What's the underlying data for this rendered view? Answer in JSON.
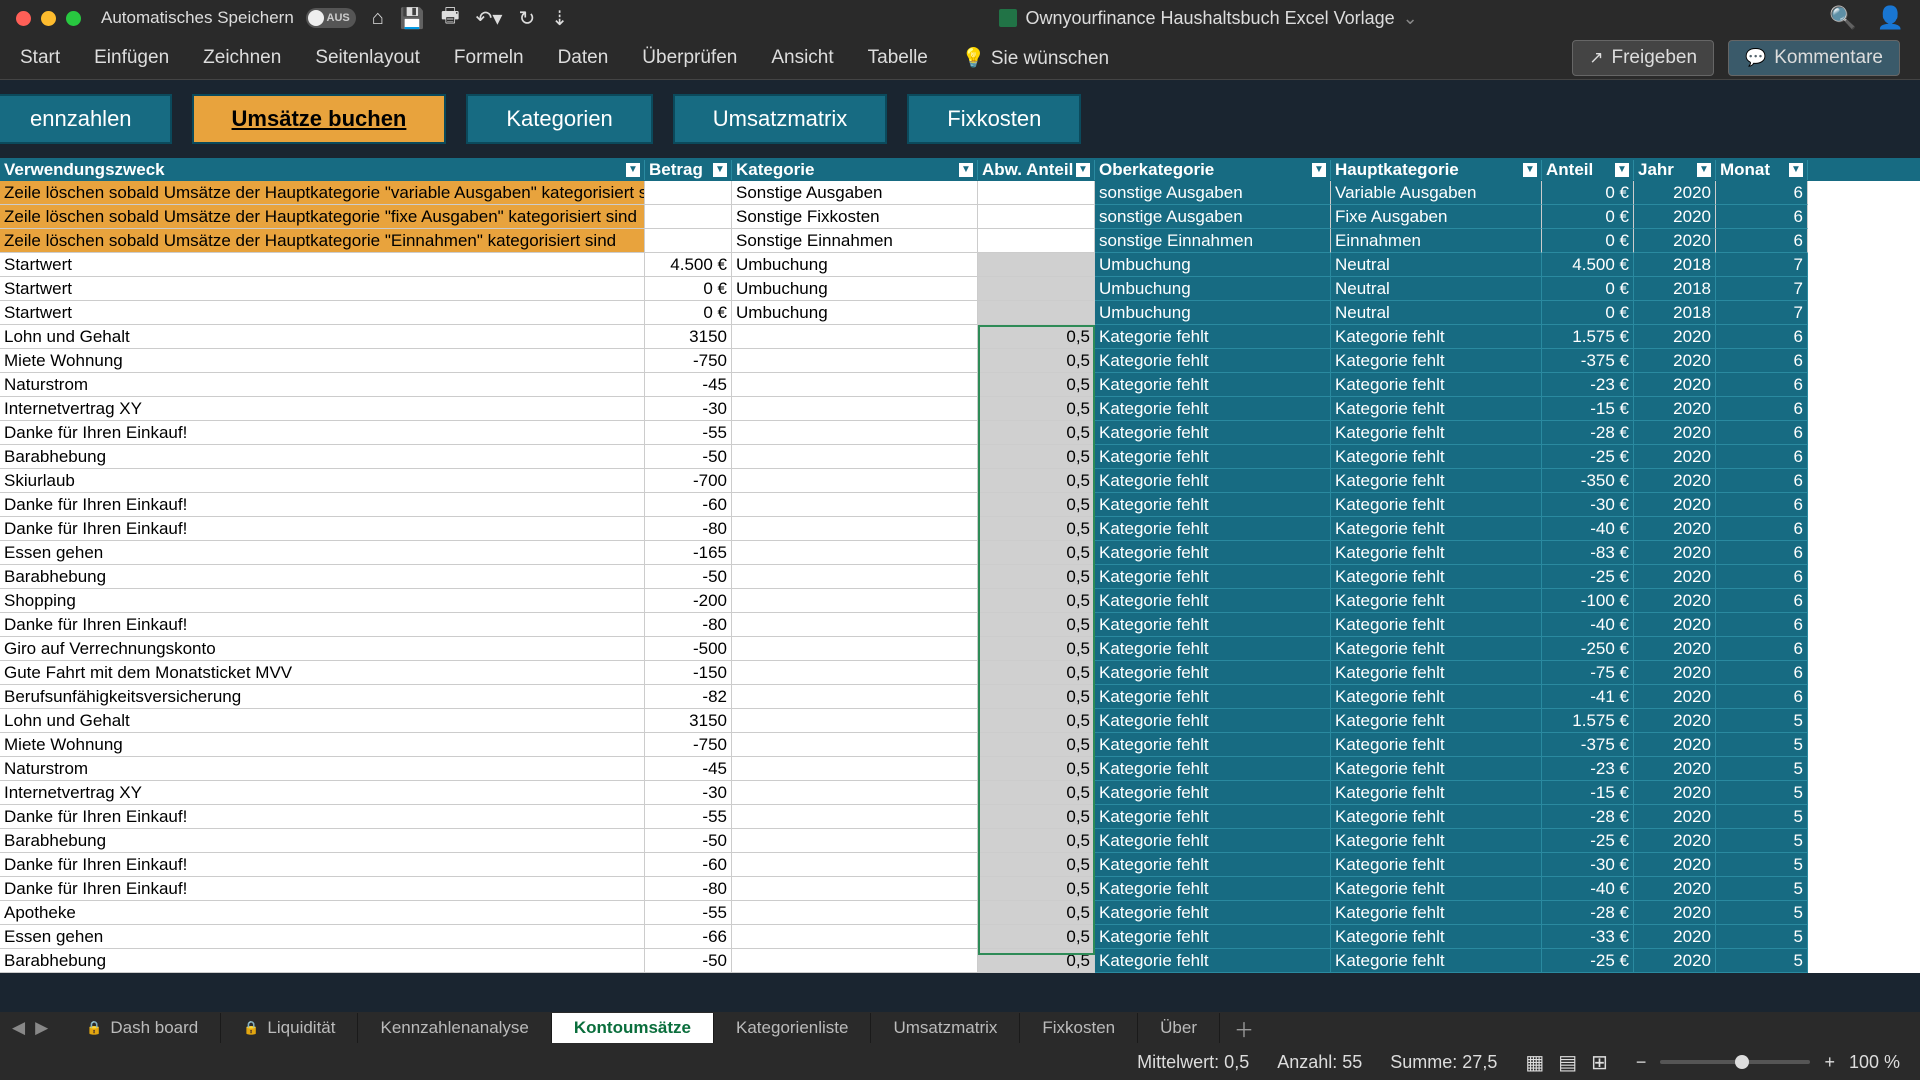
{
  "titlebar": {
    "autosave_label": "Automatisches Speichern",
    "autosave_state": "AUS",
    "doc_title": "Ownyourfinance Haushaltsbuch Excel Vorlage"
  },
  "ribbon": {
    "tabs": [
      "Start",
      "Einfügen",
      "Zeichnen",
      "Seitenlayout",
      "Formeln",
      "Daten",
      "Überprüfen",
      "Ansicht",
      "Tabelle",
      "Sie wünschen"
    ],
    "share": "Freigeben",
    "comments": "Kommentare"
  },
  "nav": {
    "kennzahlen": "ennzahlen",
    "umsaetze": "Umsätze buchen",
    "kategorien": "Kategorien",
    "umsatzmatrix": "Umsatzmatrix",
    "fixkosten": "Fixkosten"
  },
  "headers": {
    "verwend": "Verwendungszweck",
    "betrag": "Betrag",
    "kategorie": "Kategorie",
    "abw": "Abw. Anteil",
    "oberkat": "Oberkategorie",
    "hauptkat": "Hauptkategorie",
    "anteil": "Anteil",
    "jahr": "Jahr",
    "monat": "Monat"
  },
  "rows": [
    {
      "hi": true,
      "verwend": "Zeile löschen sobald Umsätze der Hauptkategorie \"variable Ausgaben\" kategorisiert sind",
      "betrag": "",
      "kategorie": "Sonstige Ausgaben",
      "abw": "",
      "oberkat": "sonstige Ausgaben",
      "hauptkat": "Variable Ausgaben",
      "anteil": "0 €",
      "jahr": "2020",
      "monat": "6"
    },
    {
      "hi": true,
      "verwend": "Zeile löschen sobald Umsätze der Hauptkategorie \"fixe Ausgaben\" kategorisiert sind",
      "betrag": "",
      "kategorie": "Sonstige Fixkosten",
      "abw": "",
      "oberkat": "sonstige Ausgaben",
      "hauptkat": "Fixe Ausgaben",
      "anteil": "0 €",
      "jahr": "2020",
      "monat": "6"
    },
    {
      "hi": true,
      "verwend": "Zeile löschen sobald Umsätze der Hauptkategorie \"Einnahmen\" kategorisiert sind",
      "betrag": "",
      "kategorie": "Sonstige Einnahmen",
      "abw": "",
      "oberkat": "sonstige Einnahmen",
      "hauptkat": "Einnahmen",
      "anteil": "0 €",
      "jahr": "2020",
      "monat": "6"
    },
    {
      "verwend": "Startwert",
      "betrag": "4.500 €",
      "kategorie": "Umbuchung",
      "abw": "",
      "oberkat": "Umbuchung",
      "hauptkat": "Neutral",
      "anteil": "4.500 €",
      "jahr": "2018",
      "monat": "7"
    },
    {
      "verwend": "Startwert",
      "betrag": "0 €",
      "kategorie": "Umbuchung",
      "abw": "",
      "oberkat": "Umbuchung",
      "hauptkat": "Neutral",
      "anteil": "0 €",
      "jahr": "2018",
      "monat": "7"
    },
    {
      "verwend": "Startwert",
      "betrag": "0 €",
      "kategorie": "Umbuchung",
      "abw": "",
      "oberkat": "Umbuchung",
      "hauptkat": "Neutral",
      "anteil": "0 €",
      "jahr": "2018",
      "monat": "7"
    },
    {
      "verwend": "Lohn und Gehalt",
      "betrag": "3150",
      "kategorie": "",
      "abw": "0,5",
      "oberkat": "Kategorie fehlt",
      "hauptkat": "Kategorie fehlt",
      "anteil": "1.575 €",
      "jahr": "2020",
      "monat": "6"
    },
    {
      "verwend": "Miete Wohnung",
      "betrag": "-750",
      "kategorie": "",
      "abw": "0,5",
      "oberkat": "Kategorie fehlt",
      "hauptkat": "Kategorie fehlt",
      "anteil": "-375 €",
      "jahr": "2020",
      "monat": "6"
    },
    {
      "verwend": "Naturstrom",
      "betrag": "-45",
      "kategorie": "",
      "abw": "0,5",
      "oberkat": "Kategorie fehlt",
      "hauptkat": "Kategorie fehlt",
      "anteil": "-23 €",
      "jahr": "2020",
      "monat": "6"
    },
    {
      "verwend": "Internetvertrag XY",
      "betrag": "-30",
      "kategorie": "",
      "abw": "0,5",
      "oberkat": "Kategorie fehlt",
      "hauptkat": "Kategorie fehlt",
      "anteil": "-15 €",
      "jahr": "2020",
      "monat": "6"
    },
    {
      "verwend": "Danke für Ihren Einkauf!",
      "betrag": "-55",
      "kategorie": "",
      "abw": "0,5",
      "oberkat": "Kategorie fehlt",
      "hauptkat": "Kategorie fehlt",
      "anteil": "-28 €",
      "jahr": "2020",
      "monat": "6"
    },
    {
      "verwend": "Barabhebung",
      "betrag": "-50",
      "kategorie": "",
      "abw": "0,5",
      "oberkat": "Kategorie fehlt",
      "hauptkat": "Kategorie fehlt",
      "anteil": "-25 €",
      "jahr": "2020",
      "monat": "6"
    },
    {
      "verwend": "Skiurlaub",
      "betrag": "-700",
      "kategorie": "",
      "abw": "0,5",
      "oberkat": "Kategorie fehlt",
      "hauptkat": "Kategorie fehlt",
      "anteil": "-350 €",
      "jahr": "2020",
      "monat": "6"
    },
    {
      "verwend": "Danke für Ihren Einkauf!",
      "betrag": "-60",
      "kategorie": "",
      "abw": "0,5",
      "oberkat": "Kategorie fehlt",
      "hauptkat": "Kategorie fehlt",
      "anteil": "-30 €",
      "jahr": "2020",
      "monat": "6"
    },
    {
      "verwend": "Danke für Ihren Einkauf!",
      "betrag": "-80",
      "kategorie": "",
      "abw": "0,5",
      "oberkat": "Kategorie fehlt",
      "hauptkat": "Kategorie fehlt",
      "anteil": "-40 €",
      "jahr": "2020",
      "monat": "6"
    },
    {
      "verwend": "Essen gehen",
      "betrag": "-165",
      "kategorie": "",
      "abw": "0,5",
      "oberkat": "Kategorie fehlt",
      "hauptkat": "Kategorie fehlt",
      "anteil": "-83 €",
      "jahr": "2020",
      "monat": "6"
    },
    {
      "verwend": "Barabhebung",
      "betrag": "-50",
      "kategorie": "",
      "abw": "0,5",
      "oberkat": "Kategorie fehlt",
      "hauptkat": "Kategorie fehlt",
      "anteil": "-25 €",
      "jahr": "2020",
      "monat": "6"
    },
    {
      "verwend": "Shopping",
      "betrag": "-200",
      "kategorie": "",
      "abw": "0,5",
      "oberkat": "Kategorie fehlt",
      "hauptkat": "Kategorie fehlt",
      "anteil": "-100 €",
      "jahr": "2020",
      "monat": "6"
    },
    {
      "verwend": "Danke für Ihren Einkauf!",
      "betrag": "-80",
      "kategorie": "",
      "abw": "0,5",
      "oberkat": "Kategorie fehlt",
      "hauptkat": "Kategorie fehlt",
      "anteil": "-40 €",
      "jahr": "2020",
      "monat": "6"
    },
    {
      "verwend": "Giro auf Verrechnungskonto",
      "betrag": "-500",
      "kategorie": "",
      "abw": "0,5",
      "oberkat": "Kategorie fehlt",
      "hauptkat": "Kategorie fehlt",
      "anteil": "-250 €",
      "jahr": "2020",
      "monat": "6"
    },
    {
      "verwend": "Gute Fahrt mit dem Monatsticket MVV",
      "betrag": "-150",
      "kategorie": "",
      "abw": "0,5",
      "oberkat": "Kategorie fehlt",
      "hauptkat": "Kategorie fehlt",
      "anteil": "-75 €",
      "jahr": "2020",
      "monat": "6"
    },
    {
      "verwend": "Berufsunfähigkeitsversicherung",
      "betrag": "-82",
      "kategorie": "",
      "abw": "0,5",
      "oberkat": "Kategorie fehlt",
      "hauptkat": "Kategorie fehlt",
      "anteil": "-41 €",
      "jahr": "2020",
      "monat": "6"
    },
    {
      "verwend": "Lohn und Gehalt",
      "betrag": "3150",
      "kategorie": "",
      "abw": "0,5",
      "oberkat": "Kategorie fehlt",
      "hauptkat": "Kategorie fehlt",
      "anteil": "1.575 €",
      "jahr": "2020",
      "monat": "5"
    },
    {
      "verwend": "Miete Wohnung",
      "betrag": "-750",
      "kategorie": "",
      "abw": "0,5",
      "oberkat": "Kategorie fehlt",
      "hauptkat": "Kategorie fehlt",
      "anteil": "-375 €",
      "jahr": "2020",
      "monat": "5"
    },
    {
      "verwend": "Naturstrom",
      "betrag": "-45",
      "kategorie": "",
      "abw": "0,5",
      "oberkat": "Kategorie fehlt",
      "hauptkat": "Kategorie fehlt",
      "anteil": "-23 €",
      "jahr": "2020",
      "monat": "5"
    },
    {
      "verwend": "Internetvertrag XY",
      "betrag": "-30",
      "kategorie": "",
      "abw": "0,5",
      "oberkat": "Kategorie fehlt",
      "hauptkat": "Kategorie fehlt",
      "anteil": "-15 €",
      "jahr": "2020",
      "monat": "5"
    },
    {
      "verwend": "Danke für Ihren Einkauf!",
      "betrag": "-55",
      "kategorie": "",
      "abw": "0,5",
      "oberkat": "Kategorie fehlt",
      "hauptkat": "Kategorie fehlt",
      "anteil": "-28 €",
      "jahr": "2020",
      "monat": "5"
    },
    {
      "verwend": "Barabhebung",
      "betrag": "-50",
      "kategorie": "",
      "abw": "0,5",
      "oberkat": "Kategorie fehlt",
      "hauptkat": "Kategorie fehlt",
      "anteil": "-25 €",
      "jahr": "2020",
      "monat": "5"
    },
    {
      "verwend": "Danke für Ihren Einkauf!",
      "betrag": "-60",
      "kategorie": "",
      "abw": "0,5",
      "oberkat": "Kategorie fehlt",
      "hauptkat": "Kategorie fehlt",
      "anteil": "-30 €",
      "jahr": "2020",
      "monat": "5"
    },
    {
      "verwend": "Danke für Ihren Einkauf!",
      "betrag": "-80",
      "kategorie": "",
      "abw": "0,5",
      "oberkat": "Kategorie fehlt",
      "hauptkat": "Kategorie fehlt",
      "anteil": "-40 €",
      "jahr": "2020",
      "monat": "5"
    },
    {
      "verwend": "Apotheke",
      "betrag": "-55",
      "kategorie": "",
      "abw": "0,5",
      "oberkat": "Kategorie fehlt",
      "hauptkat": "Kategorie fehlt",
      "anteil": "-28 €",
      "jahr": "2020",
      "monat": "5"
    },
    {
      "verwend": "Essen gehen",
      "betrag": "-66",
      "kategorie": "",
      "abw": "0,5",
      "oberkat": "Kategorie fehlt",
      "hauptkat": "Kategorie fehlt",
      "anteil": "-33 €",
      "jahr": "2020",
      "monat": "5"
    },
    {
      "verwend": "Barabhebung",
      "betrag": "-50",
      "kategorie": "",
      "abw": "0,5",
      "oberkat": "Kategorie fehlt",
      "hauptkat": "Kategorie fehlt",
      "anteil": "-25 €",
      "jahr": "2020",
      "monat": "5"
    }
  ],
  "sheets": {
    "items": [
      "Dash board",
      "Liquidität",
      "Kennzahlenanalyse",
      "Kontoumsätze",
      "Kategorienliste",
      "Umsatzmatrix",
      "Fixkosten",
      "Über"
    ],
    "active": "Kontoumsätze",
    "locked": [
      "Dash board",
      "Liquidität"
    ]
  },
  "statusbar": {
    "avg": "Mittelwert: 0,5",
    "count": "Anzahl: 55",
    "sum": "Summe: 27,5",
    "zoom": "100 %"
  }
}
